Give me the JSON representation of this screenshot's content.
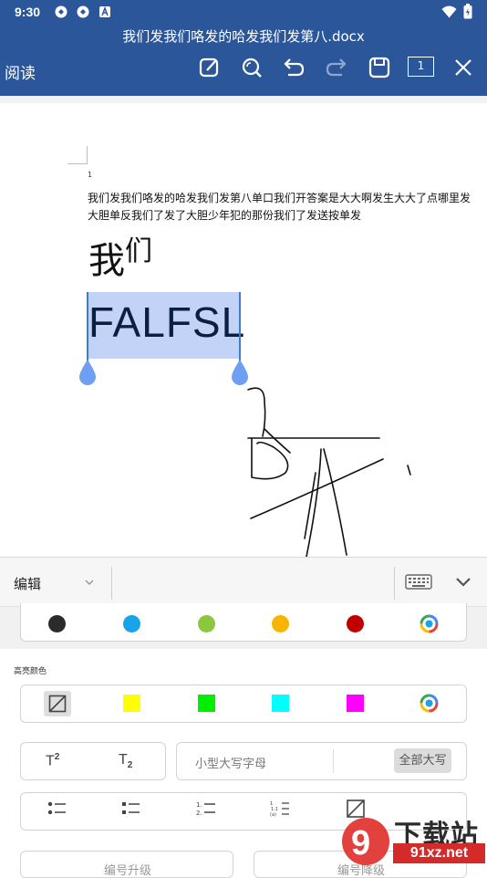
{
  "status_bar": {
    "time": "9:30",
    "left_icons": [
      "cloud-sync-icon",
      "cloud-sync-icon",
      "notification-a-icon"
    ],
    "right_icons": [
      "wifi-icon",
      "battery-icon"
    ]
  },
  "toolbar": {
    "doc_title": "我们发我们咯发的哈发我们发第八.docx",
    "mode_label": "阅读",
    "page_indicator": "1",
    "icons": [
      "edit-icon",
      "search-icon",
      "undo-icon",
      "redo-icon",
      "save-icon",
      "page-count-icon",
      "close-icon"
    ]
  },
  "document": {
    "page_number": "1",
    "paragraph_line1": "我们发我们咯发的哈发我们发第八单口我们开答案是大大啊发生大大了点哪里发",
    "paragraph_line2": "大胆单反我们了发了大胆少年犯的那份我们了发送按单发",
    "big_text": "我",
    "big_text_super": "们",
    "selected_text": "FALFSL"
  },
  "panel": {
    "tab_label": "编辑",
    "font_colors": [
      "#2b2b2b",
      "#1aa3e8",
      "#8dc63f",
      "#f7b500",
      "#c00000"
    ],
    "highlight_label": "高亮颜色",
    "highlight_colors": [
      "#ffff00",
      "#00ee00",
      "#00ffff",
      "#ff00ff"
    ],
    "superscript_label": "T",
    "superscript_mark": "2",
    "subscript_label": "T",
    "subscript_mark": "2",
    "small_caps_label": "小型大写字母",
    "all_caps_label": "全部大写",
    "bottom_left_label": "编号升级",
    "bottom_right_label": "编号降级"
  },
  "watermark": {
    "brand_text": "下载站",
    "url_text": "91xz.net"
  }
}
